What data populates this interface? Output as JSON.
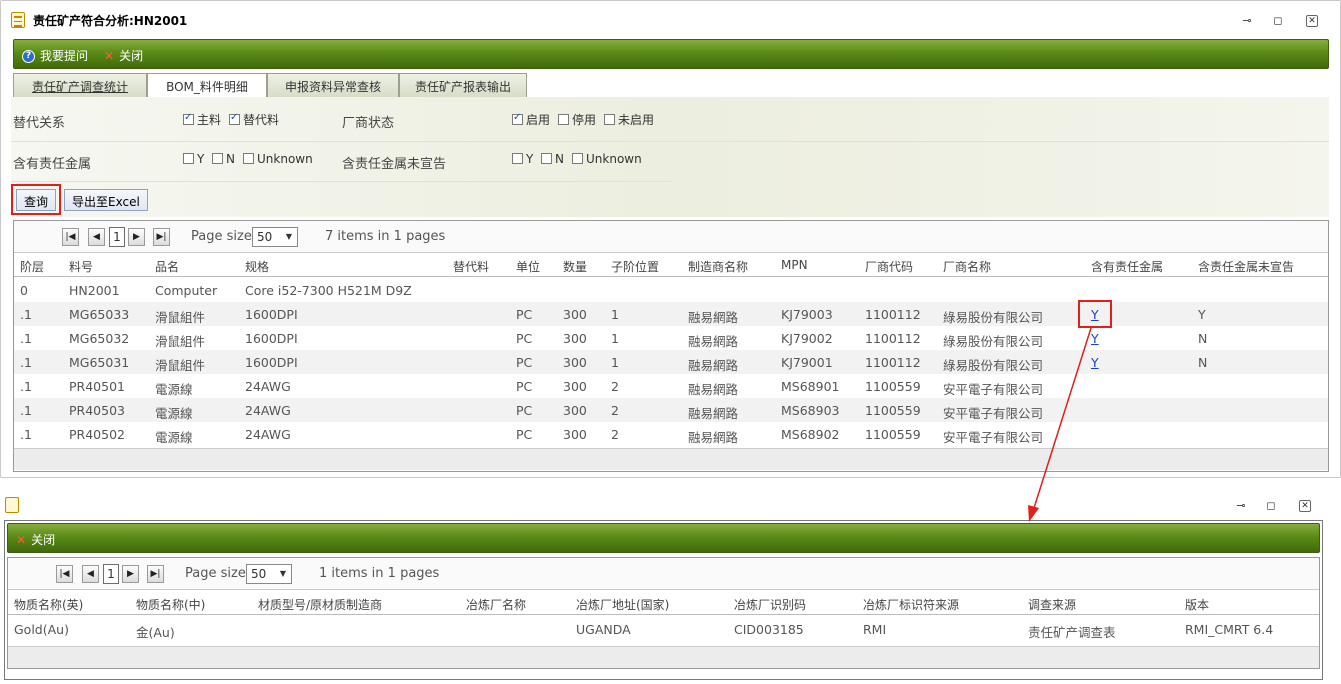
{
  "window1": {
    "title": "责任矿产符合分析:HN2001",
    "toolbar": {
      "help_label": "我要提问",
      "close_label": "关闭"
    },
    "tabs": [
      {
        "label": "责任矿产调查统计"
      },
      {
        "label": "BOM_料件明细"
      },
      {
        "label": "申报资料异常查核"
      },
      {
        "label": "责任矿产报表输出"
      }
    ],
    "filters": {
      "substitute_label": "替代关系",
      "main_label": "主料",
      "sub_label": "替代料",
      "vendor_status_label": "厂商状态",
      "enabled_label": "启用",
      "disabled_label": "停用",
      "not_enabled_label": "未启用",
      "contains_metal_label": "含有责任金属",
      "undeclared_label": "含责任金属未宣告",
      "y_label": "Y",
      "n_label": "N",
      "unknown_label": "Unknown"
    },
    "buttons": {
      "query_label": "查询",
      "export_label": "导出至Excel"
    },
    "pager": {
      "page": "1",
      "page_size_label": "Page size:",
      "page_size": "50",
      "summary": "7 items in 1 pages"
    },
    "columns": [
      "阶层",
      "料号",
      "品名",
      "规格",
      "替代料",
      "单位",
      "数量",
      "子阶位置",
      "制造商名称",
      "MPN",
      "厂商代码",
      "厂商名称",
      "含有责任金属",
      "含责任金属未宣告"
    ],
    "rows": [
      [
        "0",
        "HN2001",
        "Computer",
        "Core i52-7300 H521M D9Z",
        "",
        "",
        "",
        "",
        "",
        "",
        "",
        "",
        "",
        ""
      ],
      [
        ".1",
        "MG65033",
        "滑鼠組件",
        "1600DPI",
        "",
        "PC",
        "300",
        "1",
        "融易網路",
        "KJ79003",
        "1100112",
        "綠易股份有限公司",
        "Y",
        "Y"
      ],
      [
        ".1",
        "MG65032",
        "滑鼠組件",
        "1600DPI",
        "",
        "PC",
        "300",
        "1",
        "融易網路",
        "KJ79002",
        "1100112",
        "綠易股份有限公司",
        "Y",
        "N"
      ],
      [
        ".1",
        "MG65031",
        "滑鼠組件",
        "1600DPI",
        "",
        "PC",
        "300",
        "1",
        "融易網路",
        "KJ79001",
        "1100112",
        "綠易股份有限公司",
        "Y",
        "N"
      ],
      [
        ".1",
        "PR40501",
        "電源線",
        "24AWG",
        "",
        "PC",
        "300",
        "2",
        "融易網路",
        "MS68901",
        "1100559",
        "安平電子有限公司",
        "",
        ""
      ],
      [
        ".1",
        "PR40503",
        "電源線",
        "24AWG",
        "",
        "PC",
        "300",
        "2",
        "融易網路",
        "MS68903",
        "1100559",
        "安平電子有限公司",
        "",
        ""
      ],
      [
        ".1",
        "PR40502",
        "電源線",
        "24AWG",
        "",
        "PC",
        "300",
        "2",
        "融易網路",
        "MS68902",
        "1100559",
        "安平電子有限公司",
        "",
        ""
      ]
    ]
  },
  "window2": {
    "toolbar": {
      "close_label": "关闭"
    },
    "pager": {
      "page": "1",
      "page_size_label": "Page size:",
      "page_size": "50",
      "summary": "1 items in 1 pages"
    },
    "columns": [
      "物质名称(英)",
      "物质名称(中)",
      "材质型号/原材质制造商",
      "冶炼厂名称",
      "冶炼厂地址(国家)",
      "冶炼厂识别码",
      "冶炼厂标识符来源",
      "调查来源",
      "版本"
    ],
    "rows": [
      [
        "Gold(Au)",
        "金(Au)",
        "",
        "",
        "UGANDA",
        "CID003185",
        "RMI",
        "责任矿产调查表",
        "RMI_CMRT 6.4"
      ]
    ]
  },
  "colors": {
    "toolbar_green": "#5b8b18",
    "highlight_red": "#e0201a",
    "link_blue": "#1a3fcc"
  }
}
